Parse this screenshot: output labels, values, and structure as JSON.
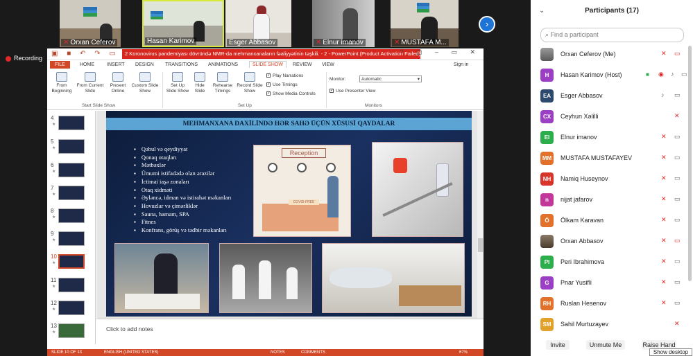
{
  "videos": [
    {
      "name": "Orxan Ceferov",
      "muted": true
    },
    {
      "name": "Hasan Karimov",
      "muted": false
    },
    {
      "name": "Esger Abbasov",
      "muted": false
    },
    {
      "name": "Elnur imanov",
      "muted": true
    },
    {
      "name": "MUSTAFA M...",
      "muted": true
    }
  ],
  "recording_label": "Recording",
  "ppt": {
    "title": "2 Koronovirus pandemiyası dövründə NMR-da mehmanxanaların fəaliyyətinin təşkili. - 2 - PowerPoint (Product Activation Failed)",
    "signin": "Sign in",
    "tabs": [
      "FILE",
      "HOME",
      "INSERT",
      "DESIGN",
      "TRANSITIONS",
      "ANIMATIONS",
      "SLIDE SHOW",
      "REVIEW",
      "VIEW"
    ],
    "active_tab": "SLIDE SHOW",
    "ribbon": {
      "from_beginning": "From Beginning",
      "from_current": "From Current Slide",
      "present_online": "Present Online",
      "custom_show": "Custom Slide Show",
      "group_start": "Start Slide Show",
      "set_up": "Set Up Slide Show",
      "hide_slide": "Hide Slide",
      "rehearse": "Rehearse Timings",
      "record": "Record Slide Show",
      "play_narrations": "Play Narrations",
      "use_timings": "Use Timings",
      "show_media": "Show Media Controls",
      "group_setup": "Set Up",
      "monitor_label": "Monitor:",
      "monitor_value": "Automatic",
      "presenter_view": "Use Presenter View",
      "group_monitors": "Monitors"
    },
    "thumbnails": [
      "4",
      "5",
      "6",
      "7",
      "8",
      "9",
      "10",
      "11",
      "12",
      "13"
    ],
    "active_slide": "10",
    "slide": {
      "title": "MEHMANXANA DAXİLİNDƏ HƏR SAHƏ ÜÇÜN XÜSUSİ QAYDALAR",
      "bullets": [
        "Qəbul və qeydiyyat",
        "Qonaq otaqları",
        "Mətbəxlər",
        "Ümumi istifadədə olan ərazilər",
        "İctimai iaşə zonaları",
        "Otaq xidməti",
        "Əyləncə, idman və istirahət məkanları",
        "Hovuzlar və çimərliklər",
        "Sauna, hamam, SPA",
        "Fitnes",
        "Konfrans, görüş və tədbir məkanları"
      ],
      "reception_sign": "Reception",
      "covid_sign": "COVID-FREE"
    },
    "notes_placeholder": "Click to add notes",
    "status": {
      "slide_counter": "SLIDE 10 OF 13",
      "language": "ENGLISH (UNITED STATES)",
      "notes": "NOTES",
      "comments": "COMMENTS",
      "zoom": "67%"
    }
  },
  "participants": {
    "header": "Participants (17)",
    "search_placeholder": "Find a participant",
    "list": [
      {
        "initials": "",
        "name": "Orxan Ceferov (Me)",
        "color": "#8a8a8a",
        "photo": true
      },
      {
        "initials": "H",
        "name": "Hasan Karimov (Host)",
        "color": "#9b3fc4",
        "photo": false
      },
      {
        "initials": "EA",
        "name": "Esger Abbasov",
        "color": "#2d4a6e",
        "photo": false
      },
      {
        "initials": "CX",
        "name": "Ceyhun Xəlilli",
        "color": "#9b3fc4",
        "photo": false
      },
      {
        "initials": "EI",
        "name": "Elnur imanov",
        "color": "#2cae4c",
        "photo": false
      },
      {
        "initials": "MM",
        "name": "MUSTAFA MUSTAFAYEV",
        "color": "#e2712b",
        "photo": false
      },
      {
        "initials": "NH",
        "name": "Namiq Huseynov",
        "color": "#d9342b",
        "photo": false
      },
      {
        "initials": "n",
        "name": "nijat jafarov",
        "color": "#c2379a",
        "photo": false
      },
      {
        "initials": "Ö",
        "name": "Ölkam Karavan",
        "color": "#e2712b",
        "photo": false
      },
      {
        "initials": "",
        "name": "Orxan Abbasov",
        "color": "#6a5a4a",
        "photo": true
      },
      {
        "initials": "PI",
        "name": "Peri Ibrahimova",
        "color": "#2cae4c",
        "photo": false
      },
      {
        "initials": "G",
        "name": "Pnar Yusifli",
        "color": "#9b3fc4",
        "photo": false
      },
      {
        "initials": "RH",
        "name": "Ruslan Hesenov",
        "color": "#e2712b",
        "photo": false
      },
      {
        "initials": "SM",
        "name": "Sahil Murtuzayev",
        "color": "#e2a12b",
        "photo": false
      }
    ],
    "buttons": {
      "invite": "Invite",
      "unmute": "Unmute Me",
      "raise": "Raise Hand"
    },
    "tooltip": "Show desktop"
  }
}
